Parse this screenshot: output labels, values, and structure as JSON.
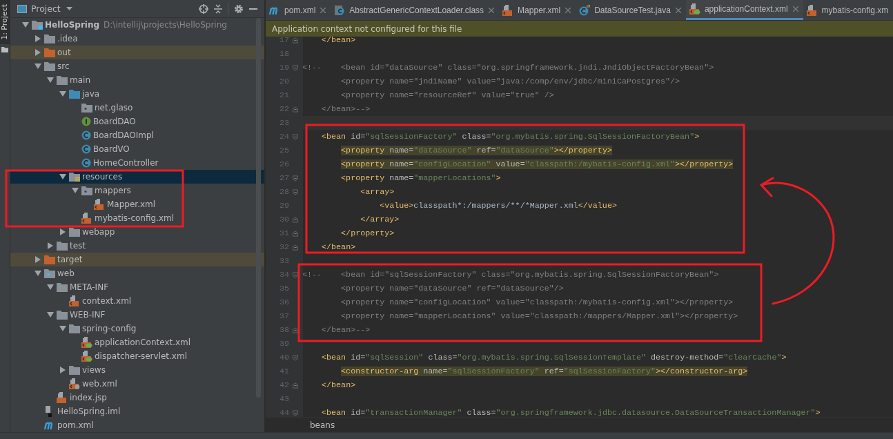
{
  "tool_strip": {
    "label": "1: Project"
  },
  "project_panel": {
    "title": "Project",
    "tree": [
      {
        "label": "HelloSpring",
        "path": "D:\\intellij\\projects\\HelloSpring",
        "kind": "module",
        "expanded": true,
        "selected": false,
        "children": [
          {
            "label": ".idea",
            "kind": "folder",
            "expanded": false,
            "selected": false
          },
          {
            "label": "out",
            "kind": "excluded-folder",
            "expanded": false,
            "selected": false
          },
          {
            "label": "src",
            "kind": "folder",
            "expanded": true,
            "selected": false,
            "children": [
              {
                "label": "main",
                "kind": "folder",
                "expanded": true,
                "selected": false,
                "children": [
                  {
                    "label": "java",
                    "kind": "source-folder",
                    "expanded": true,
                    "selected": false,
                    "children": [
                      {
                        "label": "net.glaso",
                        "kind": "package",
                        "selected": false
                      },
                      {
                        "label": "BoardDAO",
                        "kind": "interface",
                        "selected": false
                      },
                      {
                        "label": "BoardDAOImpl",
                        "kind": "class",
                        "selected": false
                      },
                      {
                        "label": "BoardVO",
                        "kind": "class",
                        "selected": false
                      },
                      {
                        "label": "HomeController",
                        "kind": "class",
                        "selected": false
                      }
                    ]
                  },
                  {
                    "label": "resources",
                    "kind": "resources-folder",
                    "expanded": true,
                    "selected": true,
                    "children": [
                      {
                        "label": "mappers",
                        "kind": "package",
                        "expanded": true,
                        "selected": false,
                        "children": [
                          {
                            "label": "Mapper.xml",
                            "kind": "xml",
                            "selected": false
                          }
                        ]
                      },
                      {
                        "label": "mybatis-config.xml",
                        "kind": "xml",
                        "selected": false
                      }
                    ]
                  },
                  {
                    "label": "webapp",
                    "kind": "folder",
                    "expanded": false,
                    "selected": false
                  }
                ]
              },
              {
                "label": "test",
                "kind": "folder",
                "expanded": false,
                "selected": false
              }
            ]
          },
          {
            "label": "target",
            "kind": "excluded-folder",
            "expanded": false,
            "selected": false
          },
          {
            "label": "web",
            "kind": "web-folder",
            "expanded": true,
            "selected": false,
            "children": [
              {
                "label": "META-INF",
                "kind": "folder",
                "expanded": true,
                "selected": false,
                "children": [
                  {
                    "label": "context.xml",
                    "kind": "xml",
                    "selected": false
                  }
                ]
              },
              {
                "label": "WEB-INF",
                "kind": "folder",
                "expanded": true,
                "selected": false,
                "children": [
                  {
                    "label": "spring-config",
                    "kind": "folder",
                    "expanded": true,
                    "selected": false,
                    "children": [
                      {
                        "label": "applicationContext.xml",
                        "kind": "spring-xml",
                        "selected": false
                      },
                      {
                        "label": "dispatcher-servlet.xml",
                        "kind": "spring-xml",
                        "selected": false
                      }
                    ]
                  },
                  {
                    "label": "views",
                    "kind": "folder",
                    "expanded": false,
                    "selected": false
                  },
                  {
                    "label": "web.xml",
                    "kind": "web-xml",
                    "selected": false
                  }
                ]
              },
              {
                "label": "index.jsp",
                "kind": "jsp",
                "selected": false
              }
            ]
          },
          {
            "label": "HelloSpring.iml",
            "kind": "module-file",
            "selected": false
          },
          {
            "label": "pom.xml",
            "kind": "maven",
            "selected": false
          }
        ]
      }
    ]
  },
  "editor": {
    "tabs": [
      {
        "label": "pom.xml",
        "kind": "maven",
        "selected": false,
        "closable": true
      },
      {
        "label": "AbstractGenericContextLoader.class",
        "kind": "class-file",
        "selected": false,
        "closable": true
      },
      {
        "label": "Mapper.xml",
        "kind": "xml",
        "selected": false,
        "closable": true
      },
      {
        "label": "DataSourceTest.java",
        "kind": "test-class",
        "selected": false,
        "closable": true
      },
      {
        "label": "applicationContext.xml",
        "kind": "spring-xml",
        "selected": true,
        "closable": true
      },
      {
        "label": "mybatis-config.xm",
        "kind": "xml",
        "selected": false,
        "closable": false
      }
    ],
    "banner": "Application context not configured for this file",
    "lines": [
      {
        "num": "17",
        "kind": "fold-end",
        "tokens": [
          {
            "kind": "tag",
            "text": "    </bean>"
          }
        ]
      },
      {
        "num": "18",
        "kind": "plain"
      },
      {
        "num": "19",
        "kind": "fold-start",
        "tokens": [
          {
            "kind": "comment",
            "text": "<!--    <bean id=\"dataSource\" class=\"org.springframework.jndi.JndiObjectFactoryBean\">"
          }
        ]
      },
      {
        "num": "20",
        "kind": "plain",
        "tokens": [
          {
            "kind": "comment",
            "text": "        <property name=\"jndiName\" value=\"java:/comp/env/jdbc/miniCaPostgres\"/>"
          }
        ]
      },
      {
        "num": "21",
        "kind": "plain",
        "tokens": [
          {
            "kind": "comment",
            "text": "        <property name=\"resourceRef\" value=\"true\" />"
          }
        ]
      },
      {
        "num": "22",
        "kind": "fold-end",
        "tokens": [
          {
            "kind": "comment",
            "text": "    </bean>-->"
          }
        ]
      },
      {
        "num": "23",
        "kind": "plain",
        "current": true
      },
      {
        "num": "24",
        "kind": "fold-start",
        "tokens": [
          {
            "kind": "tag",
            "text": "    <bean "
          },
          {
            "kind": "attr",
            "text": "id="
          },
          {
            "kind": "value",
            "text": "\"sqlSessionFactory\""
          },
          {
            "kind": "attr",
            "text": " class="
          },
          {
            "kind": "value",
            "text": "\"org.mybatis.spring.SqlSessionFactoryBean\""
          },
          {
            "kind": "tag",
            "text": ">"
          }
        ]
      },
      {
        "num": "25",
        "kind": "plain",
        "highlighted": true,
        "tokens": [
          {
            "kind": "tag",
            "text": "        <property "
          },
          {
            "kind": "attr",
            "text": "name="
          },
          {
            "kind": "value",
            "text": "\"dataSource\""
          },
          {
            "kind": "attr",
            "text": " ref="
          },
          {
            "kind": "value",
            "text": "\"dataSource\""
          },
          {
            "kind": "tag",
            "text": "></property>"
          }
        ]
      },
      {
        "num": "26",
        "kind": "plain",
        "highlighted": true,
        "tokens": [
          {
            "kind": "tag",
            "text": "        <property "
          },
          {
            "kind": "attr",
            "text": "name="
          },
          {
            "kind": "value",
            "text": "\"configLocation\""
          },
          {
            "kind": "attr",
            "text": " value="
          },
          {
            "kind": "value",
            "text": "\"classpath:/mybatis-config.xml\""
          },
          {
            "kind": "tag",
            "text": "></property>"
          }
        ]
      },
      {
        "num": "27",
        "kind": "fold-start",
        "tokens": [
          {
            "kind": "tag",
            "text": "        <property "
          },
          {
            "kind": "attr",
            "text": "name="
          },
          {
            "kind": "value",
            "text": "\"mapperLocations\""
          },
          {
            "kind": "tag",
            "text": ">"
          }
        ]
      },
      {
        "num": "28",
        "kind": "fold-start",
        "tokens": [
          {
            "kind": "tag",
            "text": "            <array>"
          }
        ]
      },
      {
        "num": "29",
        "kind": "plain",
        "tokens": [
          {
            "kind": "tag",
            "text": "                <value>"
          },
          {
            "kind": "text",
            "text": "classpath*:/mappers/**/*Mapper.xml"
          },
          {
            "kind": "tag",
            "text": "</value>"
          }
        ]
      },
      {
        "num": "30",
        "kind": "fold-end",
        "tokens": [
          {
            "kind": "tag",
            "text": "            </array>"
          }
        ]
      },
      {
        "num": "31",
        "kind": "fold-end",
        "tokens": [
          {
            "kind": "tag",
            "text": "        </property>"
          }
        ]
      },
      {
        "num": "32",
        "kind": "fold-end",
        "tokens": [
          {
            "kind": "tag",
            "text": "    </bean>"
          }
        ]
      },
      {
        "num": "33",
        "kind": "plain"
      },
      {
        "num": "34",
        "kind": "fold-start",
        "tokens": [
          {
            "kind": "comment",
            "text": "<!--    <bean id=\"sqlSessionFactory\" class=\"org.mybatis.spring.SqlSessionFactoryBean\">"
          }
        ]
      },
      {
        "num": "35",
        "kind": "plain",
        "tokens": [
          {
            "kind": "comment",
            "text": "        <property name=\"dataSource\" ref=\"dataSource\"/>"
          }
        ]
      },
      {
        "num": "36",
        "kind": "plain",
        "tokens": [
          {
            "kind": "comment",
            "text": "        <property name=\"configLocation\" value=\"classpath:/mybatis-config.xml\"></property>"
          }
        ]
      },
      {
        "num": "37",
        "kind": "plain",
        "tokens": [
          {
            "kind": "comment",
            "text": "        <property name=\"mapperLocations\" value=\"classpath:/mappers/Mapper.xml\"></property>"
          }
        ]
      },
      {
        "num": "38",
        "kind": "fold-end",
        "tokens": [
          {
            "kind": "comment",
            "text": "    </bean>-->"
          }
        ]
      },
      {
        "num": "39",
        "kind": "plain"
      },
      {
        "num": "40",
        "kind": "fold-start",
        "tokens": [
          {
            "kind": "tag",
            "text": "    <bean "
          },
          {
            "kind": "attr",
            "text": "id="
          },
          {
            "kind": "value",
            "text": "\"sqlSession\""
          },
          {
            "kind": "attr",
            "text": " class="
          },
          {
            "kind": "value",
            "text": "\"org.mybatis.spring.SqlSessionTemplate\""
          },
          {
            "kind": "attr",
            "text": " destroy-method="
          },
          {
            "kind": "value",
            "text": "\"clearCache\""
          },
          {
            "kind": "tag",
            "text": ">"
          }
        ]
      },
      {
        "num": "41",
        "kind": "plain",
        "highlighted": true,
        "tokens": [
          {
            "kind": "tag",
            "text": "        <constructor-arg "
          },
          {
            "kind": "attr",
            "text": "name="
          },
          {
            "kind": "value",
            "text": "\"sqlSessionFactory\""
          },
          {
            "kind": "attr",
            "text": " ref="
          },
          {
            "kind": "value",
            "text": "\"sqlSessionFactory\""
          },
          {
            "kind": "tag",
            "text": "></constructor-arg>"
          }
        ]
      },
      {
        "num": "42",
        "kind": "fold-end",
        "tokens": [
          {
            "kind": "tag",
            "text": "    </bean>"
          }
        ]
      },
      {
        "num": "43",
        "kind": "plain"
      },
      {
        "num": "44",
        "kind": "fold-start",
        "tokens": [
          {
            "kind": "tag",
            "text": "    <bean "
          },
          {
            "kind": "attr",
            "text": "id="
          },
          {
            "kind": "value",
            "text": "\"transactionManager\""
          },
          {
            "kind": "attr",
            "text": " class="
          },
          {
            "kind": "value",
            "text": "\"org.springframework.jdbc.datasource.DataSourceTransactionManager\""
          },
          {
            "kind": "tag",
            "text": ">"
          }
        ]
      }
    ],
    "breadcrumb": "beans"
  }
}
